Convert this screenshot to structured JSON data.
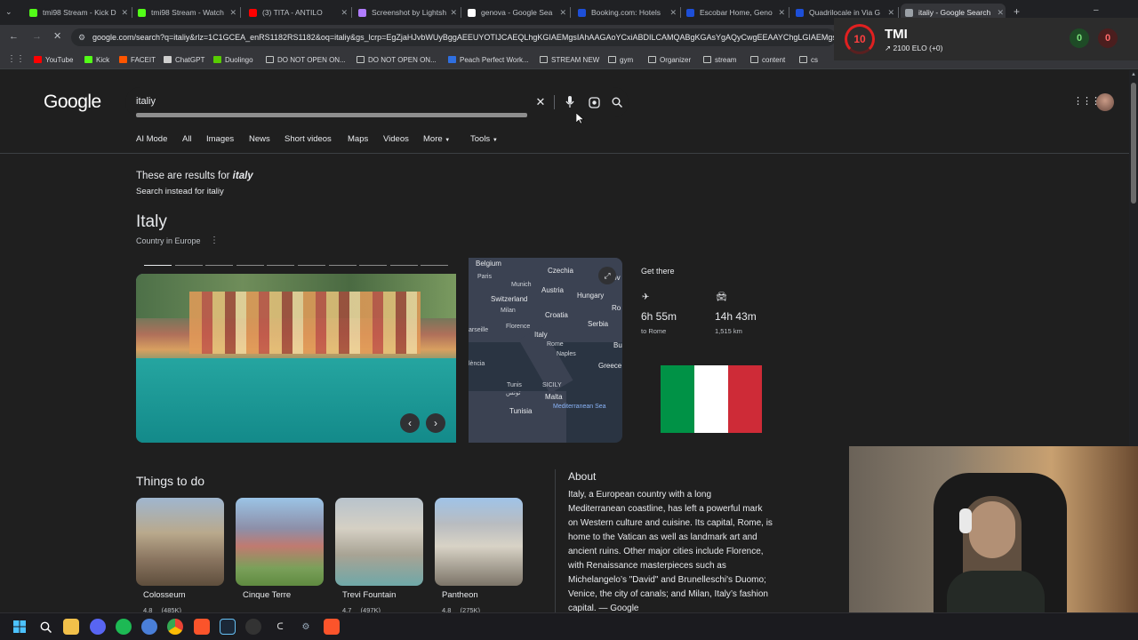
{
  "browser": {
    "tabs": [
      {
        "title": "tmi98 Stream - Kick D",
        "icon": "kick-icon",
        "color": "#53fc18"
      },
      {
        "title": "tmi98 Stream - Watch",
        "icon": "kick-icon",
        "color": "#53fc18"
      },
      {
        "title": "(3) TITA - ANTILO",
        "icon": "youtube-icon",
        "color": "#ff0000"
      },
      {
        "title": "Screenshot by Lightsh",
        "icon": "lightshot-icon",
        "color": "#b07cff"
      },
      {
        "title": "genova - Google Sea",
        "icon": "google-icon",
        "color": "#ffffff"
      },
      {
        "title": "Booking.com: Hotels",
        "icon": "booking-icon",
        "color": "#1d4fd8"
      },
      {
        "title": "Escobar Home, Geno",
        "icon": "booking-icon",
        "color": "#1d4fd8"
      },
      {
        "title": "Quadrilocale in Via G",
        "icon": "booking-icon",
        "color": "#1d4fd8"
      },
      {
        "title": "italiy - Google Search",
        "icon": "globe-icon",
        "color": "#9aa0a6"
      }
    ],
    "url": "google.com/search?q=italiy&rlz=1C1GCEA_enRS1182RS1182&oq=italiy&gs_lcrp=EgZjaHJvbWUyBggAEEUYOTIJCAEQLhgKGIAEMgsIAhAAGAoYCxiABDILCAMQABgKGAsYgAQyCwgEEAAYChgLGIAEMgsIBRAAGAoYCxiABDIL",
    "bookmarks": [
      {
        "label": "YouTube",
        "icon": "youtube-icon"
      },
      {
        "label": "Kick",
        "icon": "kick-icon"
      },
      {
        "label": "FACEIT",
        "icon": "faceit-icon"
      },
      {
        "label": "ChatGPT",
        "icon": "chatgpt-icon"
      },
      {
        "label": "Duolingo",
        "icon": "duolingo-icon"
      },
      {
        "label": "DO NOT OPEN ON...",
        "icon": "folder-icon"
      },
      {
        "label": "DO NOT OPEN ON...",
        "icon": "folder-icon"
      },
      {
        "label": "Peach Perfect Work...",
        "icon": "bookmark-icon"
      },
      {
        "label": "STREAM NEW",
        "icon": "folder-icon"
      },
      {
        "label": "gym",
        "icon": "folder-icon"
      },
      {
        "label": "Organizer",
        "icon": "folder-icon"
      },
      {
        "label": "stream",
        "icon": "folder-icon"
      },
      {
        "label": "content",
        "icon": "folder-icon"
      },
      {
        "label": "cs",
        "icon": "folder-icon"
      }
    ]
  },
  "google": {
    "logo": "Google",
    "query": "italiy",
    "nav": [
      "AI Mode",
      "All",
      "Images",
      "News",
      "Short videos",
      "Maps",
      "Videos",
      "More",
      "Tools"
    ],
    "correction_prefix": "These are results for",
    "correction_term": "italy",
    "search_instead": "Search instead for italiy",
    "entity_title": "Italy",
    "entity_subtitle": "Country in Europe",
    "get_there": "Get there",
    "flight_time": "6h 55m",
    "flight_dest": "to Rome",
    "drive_time": "14h 43m",
    "drive_dist": "1,515 km",
    "map_labels": [
      "Belgium",
      "Paris",
      "Czechia",
      "Slov",
      "Munich",
      "Austria",
      "Switzerland",
      "Hungary",
      "Milan",
      "Croatia",
      "Ro",
      "arseille",
      "Florence",
      "Italy",
      "Serbia",
      "Rome",
      "Bu",
      "Naples",
      "lència",
      "Tunis",
      "Greece",
      "Malta",
      "Tunisia",
      "Mediterranean Sea",
      "SICILY",
      "تونس"
    ],
    "flag_colors": [
      "#009246",
      "#ffffff",
      "#ce2b37"
    ],
    "things_to_do_title": "Things to do",
    "things": [
      {
        "name": "Colosseum",
        "rating": "4.8",
        "count": "(485K)"
      },
      {
        "name": "Cinque Terre",
        "rating": "",
        "count": ""
      },
      {
        "name": "Trevi Fountain",
        "rating": "4.7",
        "count": "(497K)"
      },
      {
        "name": "Pantheon",
        "rating": "4.8",
        "count": "(275K)"
      }
    ],
    "about_title": "About",
    "about_lines": [
      "Italy, a European country with a long",
      "Mediterranean coastline, has left a powerful mark",
      "on Western culture and cuisine. Its capital, Rome, is",
      "home to the Vatican as well as landmark art and",
      "ancient ruins. Other major cities include Florence,",
      "with Renaissance masterpieces such as",
      "Michelangelo’s \"David\" and Brunelleschi's Duomo;",
      "Venice, the city of canals; and Milan, Italy’s fashion",
      "capital. — Google"
    ]
  },
  "overlay": {
    "level": "10",
    "name": "TMI",
    "elo": "2100 ELO (+0)",
    "score_left": "0",
    "score_right": "0"
  }
}
